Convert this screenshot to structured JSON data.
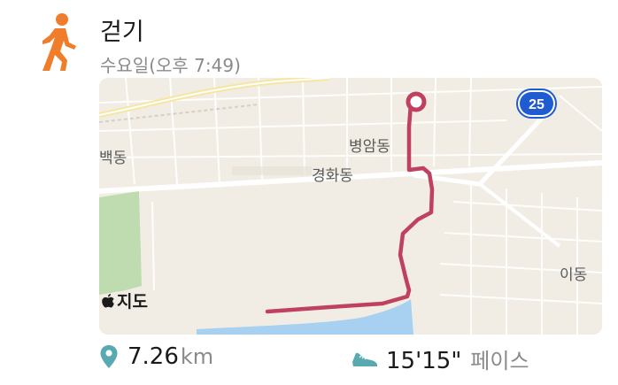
{
  "activity": {
    "icon": "walking-person-icon",
    "title": "걷기",
    "subtitle": "수요일(오후 7:49)"
  },
  "map": {
    "labels": {
      "byeongam": "병암동",
      "gyeonghwa": "경화동",
      "baek": "백동",
      "i": "이동"
    },
    "route_shield": "25",
    "attribution": "지도",
    "colors": {
      "route": "#c0415f",
      "water": "#a8d0f0",
      "park": "#bfdcb0",
      "land": "#f1ede4",
      "shield": "#1f5bd1"
    }
  },
  "stats": {
    "distance_value": "7.26",
    "distance_unit": "km",
    "pace_value": "15'15\"",
    "pace_unit": "페이스",
    "accent": "#59a9b0"
  }
}
